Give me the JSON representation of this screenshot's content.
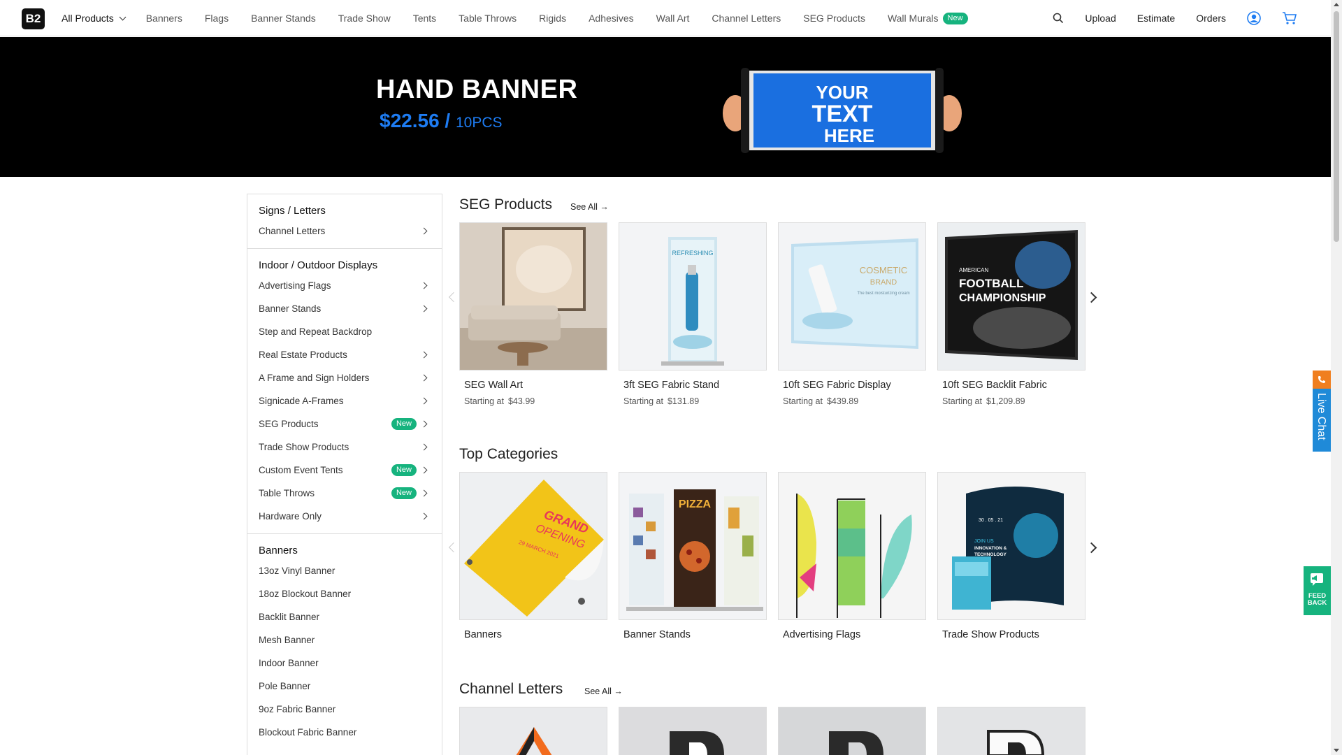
{
  "brand": {
    "logo_text": "B2",
    "accent": "#1e7cf2",
    "new_badge_color": "#16b37e"
  },
  "nav": {
    "all_products": "All Products",
    "links": [
      "Banners",
      "Flags",
      "Banner Stands",
      "Trade Show",
      "Tents",
      "Table Throws",
      "Rigids",
      "Adhesives",
      "Wall Art",
      "Channel Letters",
      "SEG Products",
      "Wall Murals"
    ],
    "new_badge": "New",
    "upload": "Upload",
    "estimate": "Estimate",
    "orders": "Orders",
    "icons": [
      "search-icon",
      "user-icon",
      "cart-icon"
    ]
  },
  "hero": {
    "title": "HAND BANNER",
    "price": "$22.56",
    "slash": "/",
    "qty": "10PCS",
    "banner_lines": [
      "YOUR",
      "TEXT",
      "HERE"
    ]
  },
  "sidebar": {
    "groups": [
      {
        "title": "Signs / Letters",
        "items": [
          {
            "label": "Channel Letters",
            "arrow": true
          }
        ]
      },
      {
        "title": "Indoor / Outdoor Displays",
        "items": [
          {
            "label": "Advertising Flags",
            "arrow": true
          },
          {
            "label": "Banner Stands",
            "arrow": true
          },
          {
            "label": "Step and Repeat Backdrop",
            "arrow": false
          },
          {
            "label": "Real Estate Products",
            "arrow": true
          },
          {
            "label": "A Frame and Sign Holders",
            "arrow": true
          },
          {
            "label": "Signicade A-Frames",
            "arrow": true
          },
          {
            "label": "SEG Products",
            "arrow": true,
            "badge": "New"
          },
          {
            "label": "Trade Show Products",
            "arrow": true
          },
          {
            "label": "Custom Event Tents",
            "arrow": true,
            "badge": "New"
          },
          {
            "label": "Table Throws",
            "arrow": true,
            "badge": "New"
          },
          {
            "label": "Hardware Only",
            "arrow": true
          }
        ]
      },
      {
        "title": "Banners",
        "items": [
          {
            "label": "13oz Vinyl Banner",
            "arrow": false
          },
          {
            "label": "18oz Blockout Banner",
            "arrow": false
          },
          {
            "label": "Backlit Banner",
            "arrow": false
          },
          {
            "label": "Mesh Banner",
            "arrow": false
          },
          {
            "label": "Indoor Banner",
            "arrow": false
          },
          {
            "label": "Pole Banner",
            "arrow": false
          },
          {
            "label": "9oz Fabric Banner",
            "arrow": false
          },
          {
            "label": "Blockout Fabric Banner",
            "arrow": false
          }
        ]
      }
    ]
  },
  "seg_section": {
    "title": "SEG Products",
    "see_all": "See All",
    "price_prefix": "Starting at",
    "cards": [
      {
        "name": "SEG Wall Art",
        "price": "$43.99"
      },
      {
        "name": "3ft SEG Fabric Stand",
        "price": "$131.89"
      },
      {
        "name": "10ft SEG Fabric Display",
        "price": "$439.89"
      },
      {
        "name": "10ft SEG Backlit Fabric",
        "price": "$1,209.89"
      }
    ],
    "image_text": {
      "stand": "REFRESHING",
      "display": [
        "COSMETIC",
        "BRAND",
        "The best moisturizing cream"
      ],
      "backlit": [
        "AMERICAN",
        "FOOTBALL",
        "CHAMPIONSHIP"
      ]
    }
  },
  "top_categories": {
    "title": "Top Categories",
    "cards": [
      {
        "name": "Banners"
      },
      {
        "name": "Banner Stands"
      },
      {
        "name": "Advertising Flags"
      },
      {
        "name": "Trade Show Products"
      }
    ],
    "image_text": {
      "banner": [
        "GRAND",
        "OPENING",
        "29 MARCH 2021"
      ],
      "stand": "PIZZA",
      "tradeshow": [
        "JOIN US",
        "INNOVATION &",
        "TECHNOLOGY",
        "30 . 05 . 21"
      ]
    }
  },
  "channel_letters": {
    "title": "Channel Letters",
    "see_all": "See All"
  },
  "widgets": {
    "live_chat": "Live Chat",
    "feedback_line1": "FEED",
    "feedback_line2": "BACK"
  }
}
